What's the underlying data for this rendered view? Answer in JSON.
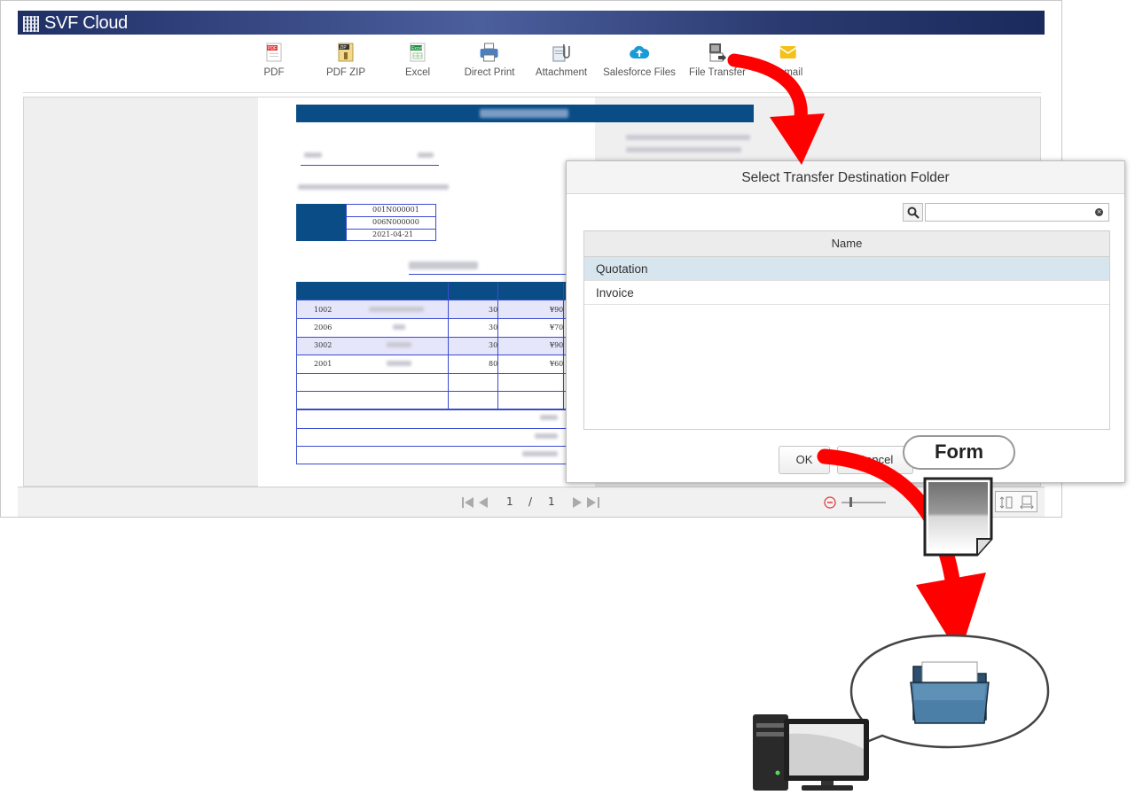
{
  "app": {
    "title": "SVF Cloud"
  },
  "toolbar": {
    "items": [
      {
        "label": "PDF",
        "icon": "pdf-icon"
      },
      {
        "label": "PDF ZIP",
        "icon": "zip-icon"
      },
      {
        "label": "Excel",
        "icon": "excel-icon"
      },
      {
        "label": "Direct Print",
        "icon": "printer-icon"
      },
      {
        "label": "Attachment",
        "icon": "attachment-icon"
      },
      {
        "label": "Salesforce Files",
        "icon": "cloud-upload-icon"
      },
      {
        "label": "File Transfer",
        "icon": "file-transfer-icon"
      },
      {
        "label": "E-mail",
        "icon": "mail-icon"
      }
    ]
  },
  "report": {
    "codes": [
      "001N000001",
      "006N000000",
      "2021-04-21"
    ],
    "rows": [
      {
        "code": "1002",
        "qty": "30",
        "price": "¥90"
      },
      {
        "code": "2006",
        "qty": "30",
        "price": "¥70"
      },
      {
        "code": "3002",
        "qty": "30",
        "price": "¥90"
      },
      {
        "code": "2001",
        "qty": "80",
        "price": "¥60"
      }
    ]
  },
  "pager": {
    "current": "1",
    "separator": "/",
    "total": "1"
  },
  "dialog": {
    "title": "Select Transfer Destination Folder",
    "search_value": "",
    "column_name": "Name",
    "folders": [
      "Quotation",
      "Invoice"
    ],
    "ok_label": "OK",
    "cancel_label": "Cancel"
  },
  "annotation": {
    "form_label": "Form"
  },
  "colors": {
    "accent_arrow": "#ff0000",
    "titlebar": "#2a3a70",
    "selected_row": "#d7e5ee",
    "report_blue": "#0a4d86"
  }
}
